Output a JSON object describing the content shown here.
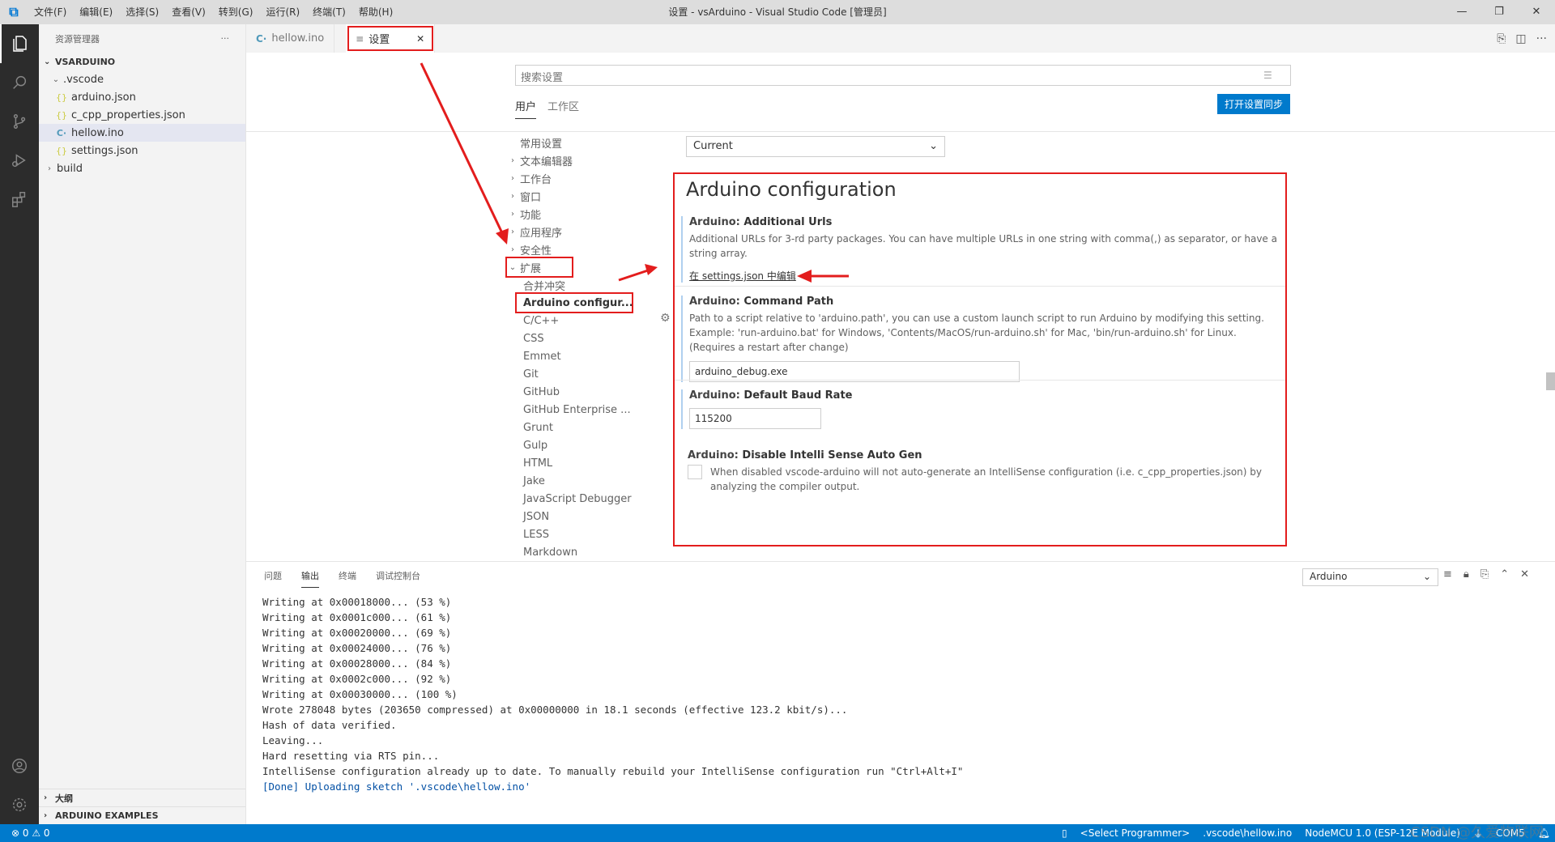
{
  "titlebar": {
    "title": "设置 - vsArduino - Visual Studio Code [管理员]",
    "menu": [
      "文件(F)",
      "编辑(E)",
      "选择(S)",
      "查看(V)",
      "转到(G)",
      "运行(R)",
      "终端(T)",
      "帮助(H)"
    ],
    "controls": [
      "—",
      "❐",
      "✕"
    ]
  },
  "sidebar": {
    "header": "资源管理器",
    "more": "···",
    "workspace": "VSARDUINO",
    "tree": [
      {
        "label": ".vscode",
        "type": "folder",
        "icon": "chevron-down"
      },
      {
        "label": "arduino.json",
        "type": "json"
      },
      {
        "label": "c_cpp_properties.json",
        "type": "json"
      },
      {
        "label": "hellow.ino",
        "type": "ino"
      },
      {
        "label": "settings.json",
        "type": "json"
      },
      {
        "label": "build",
        "type": "folder",
        "icon": "chevron-right"
      }
    ],
    "bottom_sections": [
      "大纲",
      "ARDUINO EXAMPLES"
    ]
  },
  "tabs": [
    {
      "label": "hellow.ino",
      "active": false
    },
    {
      "label": "设置",
      "active": true
    }
  ],
  "settings": {
    "search_placeholder": "搜索设置",
    "scopes": [
      "用户",
      "工作区"
    ],
    "sync_button": "打开设置同步",
    "toc": [
      {
        "label": "常用设置",
        "chev": ""
      },
      {
        "label": "文本编辑器",
        "chev": "›"
      },
      {
        "label": "工作台",
        "chev": "›"
      },
      {
        "label": "窗口",
        "chev": "›"
      },
      {
        "label": "功能",
        "chev": "›"
      },
      {
        "label": "应用程序",
        "chev": "›"
      },
      {
        "label": "安全性",
        "chev": "›"
      },
      {
        "label": "扩展",
        "chev": "⌄"
      }
    ],
    "toc_ext": [
      "合并冲突",
      "Arduino configur...",
      "C/C++",
      "CSS",
      "Emmet",
      "Git",
      "GitHub",
      "GitHub Enterprise ...",
      "Grunt",
      "Gulp",
      "HTML",
      "Jake",
      "JavaScript Debugger",
      "JSON",
      "LESS",
      "Markdown"
    ],
    "scope_select": "Current",
    "section_title": "Arduino configuration",
    "items": {
      "additional_urls": {
        "category": "Arduino: ",
        "name": "Additional Urls",
        "desc": "Additional URLs for 3-rd party packages. You can have multiple URLs in one string with comma(,) as separator, or have a string array.",
        "link": "在 settings.json 中编辑"
      },
      "command_path": {
        "category": "Arduino: ",
        "name": "Command Path",
        "desc": "Path to a script relative to 'arduino.path', you can use a custom launch script to run Arduino by modifying this setting. Example: 'run-arduino.bat' for Windows, 'Contents/MacOS/run-arduino.sh' for Mac, 'bin/run-arduino.sh' for Linux. (Requires a restart after change)",
        "value": "arduino_debug.exe"
      },
      "baud_rate": {
        "category": "Arduino: ",
        "name": "Default Baud Rate",
        "value": "115200"
      },
      "intellisense": {
        "category": "Arduino: ",
        "name": "Disable Intelli Sense Auto Gen",
        "desc": "When disabled vscode-arduino will not auto-generate an IntelliSense configuration (i.e. c_cpp_properties.json) by analyzing the compiler output."
      }
    }
  },
  "panel": {
    "tabs": [
      "问题",
      "输出",
      "终端",
      "调试控制台"
    ],
    "active_tab": "输出",
    "channel": "Arduino",
    "output_lines": [
      "Writing at 0x00018000... (53 %)",
      "Writing at 0x0001c000... (61 %)",
      "Writing at 0x00020000... (69 %)",
      "Writing at 0x00024000... (76 %)",
      "Writing at 0x00028000... (84 %)",
      "Writing at 0x0002c000... (92 %)",
      "Writing at 0x00030000... (100 %)",
      "Wrote 278048 bytes (203650 compressed) at 0x00000000 in 18.1 seconds (effective 123.2 kbit/s)...",
      "Hash of data verified.",
      "Leaving...",
      "Hard resetting via RTS pin...",
      "IntelliSense configuration already up to date. To manually rebuild your IntelliSense configuration run \"Ctrl+Alt+I\""
    ],
    "done_line": "[Done] Uploading sketch '.vscode\\hellow.ino'"
  },
  "statusbar": {
    "left": "⊗ 0 ⚠ 0",
    "items": [
      "<Select Programmer>",
      ".vscode\\hellow.ino",
      "NodeMCU 1.0 (ESP-12E Module)",
      "COM5"
    ],
    "watermark": "CSDN @久爱物联网"
  },
  "colors": {
    "accent": "#007acc",
    "highlight": "#e31d1d",
    "activity_bar": "#2c2c2c"
  }
}
